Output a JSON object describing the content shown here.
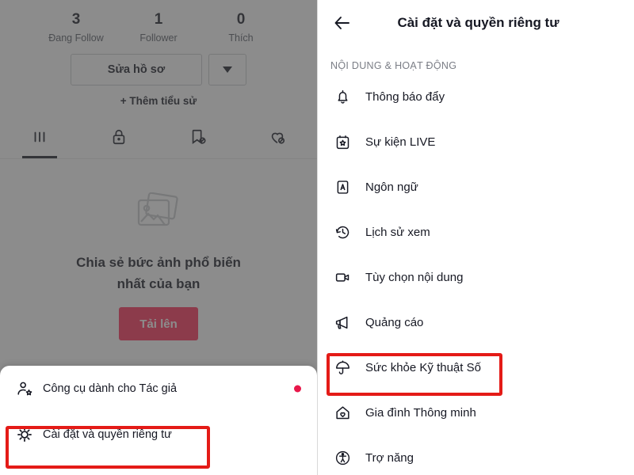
{
  "profile": {
    "username": "",
    "stats": [
      {
        "value": "3",
        "label": "Đang Follow",
        "name": "following"
      },
      {
        "value": "1",
        "label": "Follower",
        "name": "followers"
      },
      {
        "value": "0",
        "label": "Thích",
        "name": "likes"
      }
    ],
    "edit_profile_label": "Sửa hồ sơ",
    "dropdown_icon": "chevron-down-icon",
    "add_bio_label": "+ Thêm tiểu sử",
    "tabs": [
      {
        "icon": "posts-grid-icon",
        "active": true
      },
      {
        "icon": "lock-icon",
        "active": false
      },
      {
        "icon": "bookmark-hidden-icon",
        "active": false
      },
      {
        "icon": "heart-hidden-icon",
        "active": false
      }
    ],
    "empty_state": {
      "icon": "photos-stack-icon",
      "text_line1": "Chia sẻ bức ảnh phổ biến",
      "text_line2": "nhất của bạn",
      "upload_label": "Tải lên"
    }
  },
  "bottom_sheet": {
    "items": [
      {
        "icon": "person-star-icon",
        "label": "Công cụ dành cho Tác giả",
        "badge": true,
        "highlighted": false
      },
      {
        "icon": "gear-icon",
        "label": "Cài đặt và quyền riêng tư",
        "badge": false,
        "highlighted": true
      }
    ]
  },
  "settings": {
    "back_icon": "back-arrow-icon",
    "title": "Cài đặt và quyền riêng tư",
    "section_label": "NỘI DUNG & HOẠT ĐỘNG",
    "items": [
      {
        "icon": "bell-icon",
        "label": "Thông báo đẩy",
        "highlighted": false
      },
      {
        "icon": "calendar-star-icon",
        "label": "Sự kiện LIVE",
        "highlighted": false
      },
      {
        "icon": "language-a-icon",
        "label": "Ngôn ngữ",
        "highlighted": false
      },
      {
        "icon": "history-clock-icon",
        "label": "Lịch sử xem",
        "highlighted": false
      },
      {
        "icon": "video-camera-icon",
        "label": "Tùy chọn nội dung",
        "highlighted": false
      },
      {
        "icon": "megaphone-icon",
        "label": "Quảng cáo",
        "highlighted": false
      },
      {
        "icon": "umbrella-icon",
        "label": "Sức khỏe Kỹ thuật Số",
        "highlighted": true
      },
      {
        "icon": "home-heart-icon",
        "label": "Gia đình Thông minh",
        "highlighted": false
      },
      {
        "icon": "accessibility-icon",
        "label": "Trợ năng",
        "highlighted": false
      }
    ]
  },
  "colors": {
    "highlight_red": "#e41b17",
    "brand_red": "#fe2c55",
    "badge_red": "#e8174a",
    "dim_overlay": "#464646",
    "text_primary": "#161823",
    "text_secondary": "#7a7d85"
  }
}
